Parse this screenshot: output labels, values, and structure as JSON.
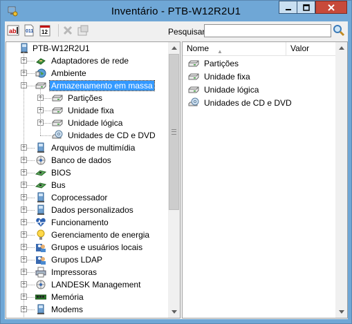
{
  "window": {
    "title": "Inventário - PTB-W12R2U1"
  },
  "toolbar": {
    "search_label": "Pesquisar:",
    "search_value": "",
    "search_placeholder": ""
  },
  "tree": {
    "root": "PTB-W12R2U1",
    "items": [
      {
        "label": "Adaptadores de rede",
        "icon": "network-adapter-icon"
      },
      {
        "label": "Ambiente",
        "icon": "environment-icon"
      },
      {
        "label": "Armazenamento em massa",
        "icon": "drive-icon",
        "selected": true,
        "expanded": true,
        "children": [
          {
            "label": "Partições",
            "icon": "drive-icon"
          },
          {
            "label": "Unidade fixa",
            "icon": "drive-icon"
          },
          {
            "label": "Unidade lógica",
            "icon": "drive-icon"
          },
          {
            "label": "Unidades de CD e DVD",
            "icon": "cd-drive-icon"
          }
        ]
      },
      {
        "label": "Arquivos de multimídia",
        "icon": "computer-icon"
      },
      {
        "label": "Banco de dados",
        "icon": "database-icon"
      },
      {
        "label": "BIOS",
        "icon": "chip-icon"
      },
      {
        "label": "Bus",
        "icon": "chip-icon"
      },
      {
        "label": "Coprocessador",
        "icon": "computer-icon"
      },
      {
        "label": "Dados personalizados",
        "icon": "computer-icon"
      },
      {
        "label": "Funcionamento",
        "icon": "health-icon"
      },
      {
        "label": "Gerenciamento de energia",
        "icon": "lightbulb-icon"
      },
      {
        "label": "Grupos e usuários locais",
        "icon": "users-icon"
      },
      {
        "label": "Grupos LDAP",
        "icon": "users-icon"
      },
      {
        "label": "Impressoras",
        "icon": "printer-icon"
      },
      {
        "label": "LANDESK Management",
        "icon": "database-icon"
      },
      {
        "label": "Memória",
        "icon": "memory-icon"
      },
      {
        "label": "Modems",
        "icon": "computer-icon"
      }
    ]
  },
  "list": {
    "columns": {
      "name": "Nome",
      "value": "Valor"
    },
    "items": [
      {
        "label": "Partições",
        "icon": "drive-icon"
      },
      {
        "label": "Unidade fixa",
        "icon": "drive-icon"
      },
      {
        "label": "Unidade lógica",
        "icon": "drive-icon"
      },
      {
        "label": "Unidades de CD e DVD",
        "icon": "cd-drive-icon"
      }
    ]
  },
  "colors": {
    "titlebar": "#6fa7d6",
    "selection": "#3399ff",
    "close_button": "#c74a3a"
  }
}
